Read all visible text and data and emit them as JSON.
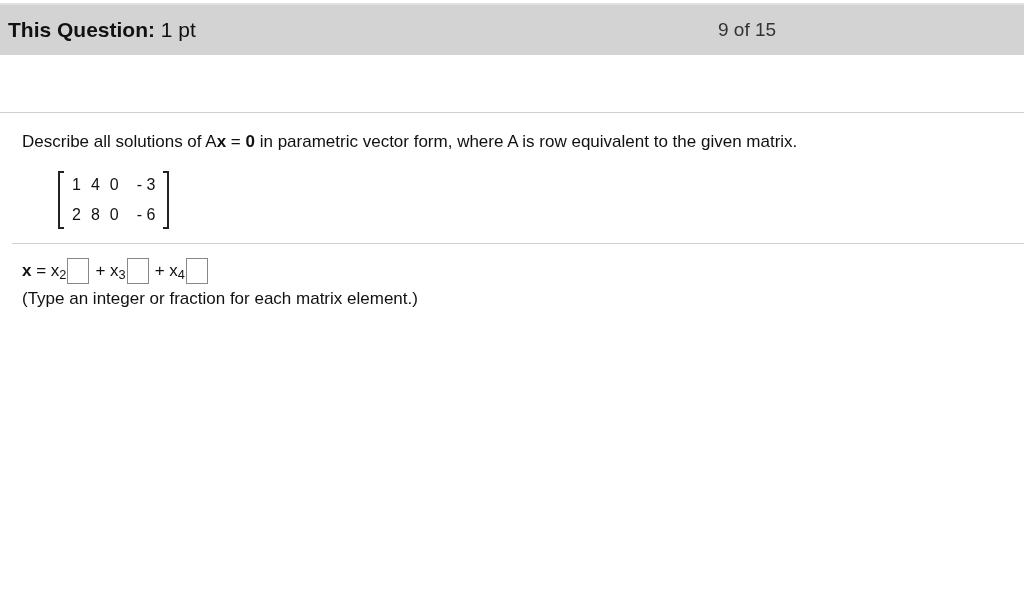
{
  "header": {
    "label": "This Question:",
    "points": "1 pt",
    "progress": "9 of 15"
  },
  "question": "Describe all solutions of A**x** = **0** in parametric vector form, where A is row equivalent to the given matrix.",
  "matrix": [
    [
      "1",
      "4",
      "0",
      "- 3"
    ],
    [
      "2",
      "8",
      "0",
      "- 6"
    ]
  ],
  "answer_terms": [
    "**x** = x$_{2}$",
    "+ x$_{3}$",
    "+ x$_{4}$"
  ],
  "hint": "(Type an integer or fraction for each matrix element.)"
}
